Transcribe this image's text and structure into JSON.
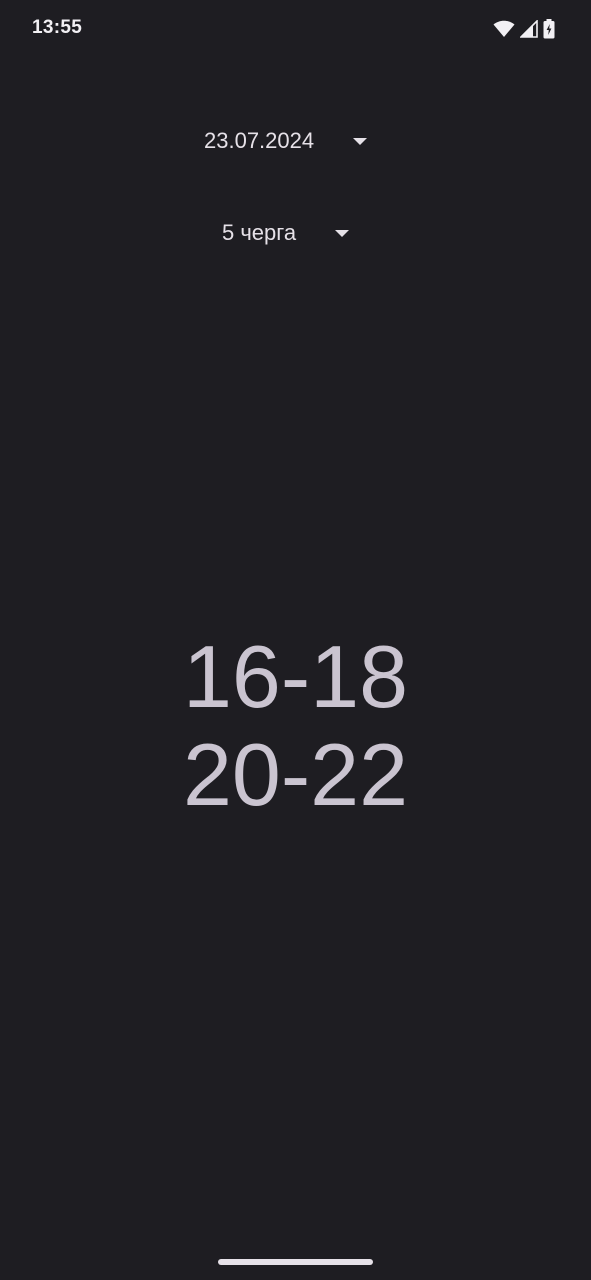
{
  "status_bar": {
    "time": "13:55",
    "icons": [
      "wifi-icon",
      "cellular-signal-icon",
      "battery-charging-icon"
    ]
  },
  "date_selector": {
    "value": "23.07.2024"
  },
  "queue_selector": {
    "value": "5 черга"
  },
  "schedule": {
    "slots": [
      "16-18",
      "20-22"
    ]
  },
  "colors": {
    "background": "#1e1d22",
    "text": "#e6e1e8",
    "schedule_text": "#cac4d0"
  }
}
